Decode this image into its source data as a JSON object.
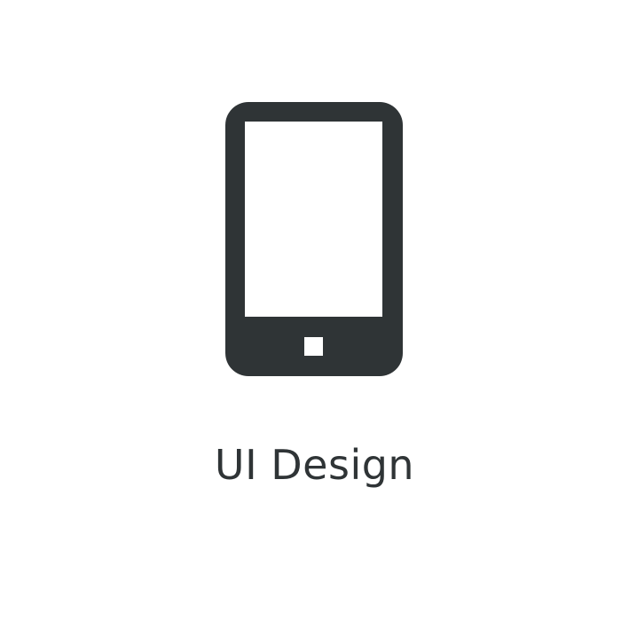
{
  "icon": {
    "name": "mobile-phone-icon",
    "color": "#2f3436"
  },
  "label": "UI Design"
}
